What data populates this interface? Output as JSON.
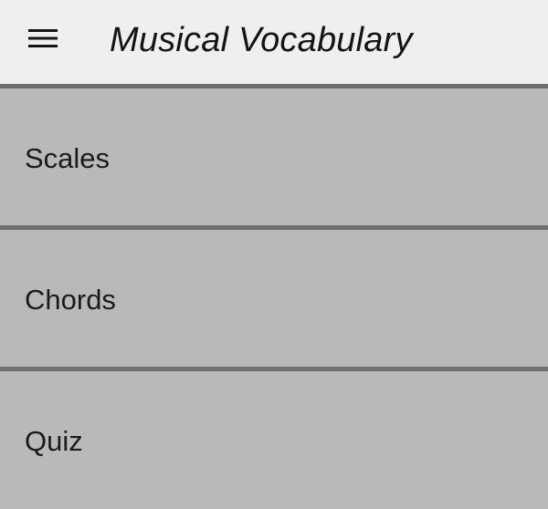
{
  "app_bar": {
    "title": "Musical Vocabulary",
    "menu_icon": "hamburger-menu-icon"
  },
  "menu": {
    "items": [
      {
        "label": "Scales"
      },
      {
        "label": "Chords"
      },
      {
        "label": "Quiz"
      }
    ]
  },
  "colors": {
    "app_bar_background": "#f0eff0",
    "item_background": "#bab9ba",
    "divider": "#6f6f70",
    "text": "#1b1b1b"
  }
}
